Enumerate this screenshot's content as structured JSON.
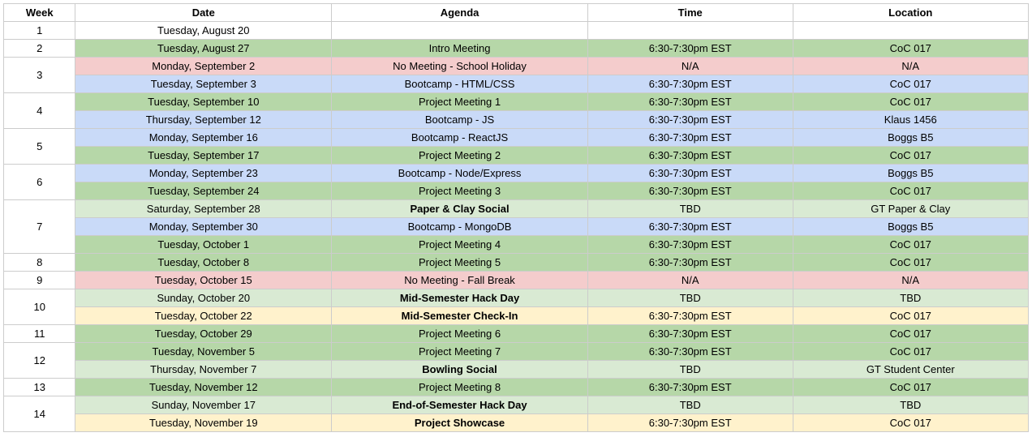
{
  "headers": {
    "week": "Week",
    "date": "Date",
    "agenda": "Agenda",
    "time": "Time",
    "location": "Location"
  },
  "weeks": [
    {
      "num": "1",
      "rows": [
        {
          "date": "Tuesday, August 20",
          "agenda": "",
          "time": "",
          "location": "",
          "cls": "c-none",
          "bold": false
        }
      ]
    },
    {
      "num": "2",
      "rows": [
        {
          "date": "Tuesday, August 27",
          "agenda": "Intro Meeting",
          "time": "6:30-7:30pm EST",
          "location": "CoC 017",
          "cls": "c-green",
          "bold": false
        }
      ]
    },
    {
      "num": "3",
      "rows": [
        {
          "date": "Monday, September 2",
          "agenda": "No Meeting - School Holiday",
          "time": "N/A",
          "location": "N/A",
          "cls": "c-red",
          "bold": false
        },
        {
          "date": "Tuesday, September 3",
          "agenda": "Bootcamp - HTML/CSS",
          "time": "6:30-7:30pm EST",
          "location": "CoC 017",
          "cls": "c-blue",
          "bold": false
        }
      ]
    },
    {
      "num": "4",
      "rows": [
        {
          "date": "Tuesday, September 10",
          "agenda": "Project Meeting 1",
          "time": "6:30-7:30pm EST",
          "location": "CoC 017",
          "cls": "c-green",
          "bold": false
        },
        {
          "date": "Thursday, September 12",
          "agenda": "Bootcamp - JS",
          "time": "6:30-7:30pm EST",
          "location": "Klaus 1456",
          "cls": "c-blue",
          "bold": false
        }
      ]
    },
    {
      "num": "5",
      "rows": [
        {
          "date": "Monday, September 16",
          "agenda": "Bootcamp - ReactJS",
          "time": "6:30-7:30pm EST",
          "location": "Boggs B5",
          "cls": "c-blue",
          "bold": false
        },
        {
          "date": "Tuesday, September 17",
          "agenda": "Project Meeting 2",
          "time": "6:30-7:30pm EST",
          "location": "CoC 017",
          "cls": "c-green",
          "bold": false
        }
      ]
    },
    {
      "num": "6",
      "rows": [
        {
          "date": "Monday, September 23",
          "agenda": "Bootcamp - Node/Express",
          "time": "6:30-7:30pm EST",
          "location": "Boggs B5",
          "cls": "c-blue",
          "bold": false
        },
        {
          "date": "Tuesday, September 24",
          "agenda": "Project Meeting 3",
          "time": "6:30-7:30pm EST",
          "location": "CoC 017",
          "cls": "c-green",
          "bold": false
        }
      ]
    },
    {
      "num": "7",
      "rows": [
        {
          "date": "Saturday, September 28",
          "agenda": "Paper & Clay Social",
          "time": "TBD",
          "location": "GT Paper & Clay",
          "cls": "c-lgreen",
          "bold": true
        },
        {
          "date": "Monday, September 30",
          "agenda": "Bootcamp - MongoDB",
          "time": "6:30-7:30pm EST",
          "location": "Boggs B5",
          "cls": "c-blue",
          "bold": false
        },
        {
          "date": "Tuesday, October 1",
          "agenda": "Project Meeting 4",
          "time": "6:30-7:30pm EST",
          "location": "CoC 017",
          "cls": "c-green",
          "bold": false
        }
      ]
    },
    {
      "num": "8",
      "rows": [
        {
          "date": "Tuesday, October 8",
          "agenda": "Project Meeting 5",
          "time": "6:30-7:30pm EST",
          "location": "CoC 017",
          "cls": "c-green",
          "bold": false
        }
      ]
    },
    {
      "num": "9",
      "rows": [
        {
          "date": "Tuesday, October 15",
          "agenda": "No Meeting - Fall Break",
          "time": "N/A",
          "location": "N/A",
          "cls": "c-red",
          "bold": false
        }
      ]
    },
    {
      "num": "10",
      "rows": [
        {
          "date": "Sunday, October 20",
          "agenda": "Mid-Semester Hack Day",
          "time": "TBD",
          "location": "TBD",
          "cls": "c-lgreen",
          "bold": true
        },
        {
          "date": "Tuesday, October 22",
          "agenda": "Mid-Semester Check-In",
          "time": "6:30-7:30pm EST",
          "location": "CoC 017",
          "cls": "c-yellow",
          "bold": true
        }
      ]
    },
    {
      "num": "11",
      "rows": [
        {
          "date": "Tuesday, October 29",
          "agenda": "Project Meeting 6",
          "time": "6:30-7:30pm EST",
          "location": "CoC 017",
          "cls": "c-green",
          "bold": false
        }
      ]
    },
    {
      "num": "12",
      "rows": [
        {
          "date": "Tuesday, November 5",
          "agenda": "Project Meeting 7",
          "time": "6:30-7:30pm EST",
          "location": "CoC 017",
          "cls": "c-green",
          "bold": false
        },
        {
          "date": "Thursday, November 7",
          "agenda": "Bowling Social",
          "time": "TBD",
          "location": "GT Student Center",
          "cls": "c-lgreen",
          "bold": true
        }
      ]
    },
    {
      "num": "13",
      "rows": [
        {
          "date": "Tuesday, November 12",
          "agenda": "Project Meeting 8",
          "time": "6:30-7:30pm EST",
          "location": "CoC 017",
          "cls": "c-green",
          "bold": false
        }
      ]
    },
    {
      "num": "14",
      "rows": [
        {
          "date": "Sunday, November 17",
          "agenda": "End-of-Semester Hack Day",
          "time": "TBD",
          "location": "TBD",
          "cls": "c-lgreen",
          "bold": true
        },
        {
          "date": "Tuesday, November 19",
          "agenda": "Project Showcase",
          "time": "6:30-7:30pm EST",
          "location": "CoC 017",
          "cls": "c-yellow",
          "bold": true
        }
      ]
    }
  ]
}
